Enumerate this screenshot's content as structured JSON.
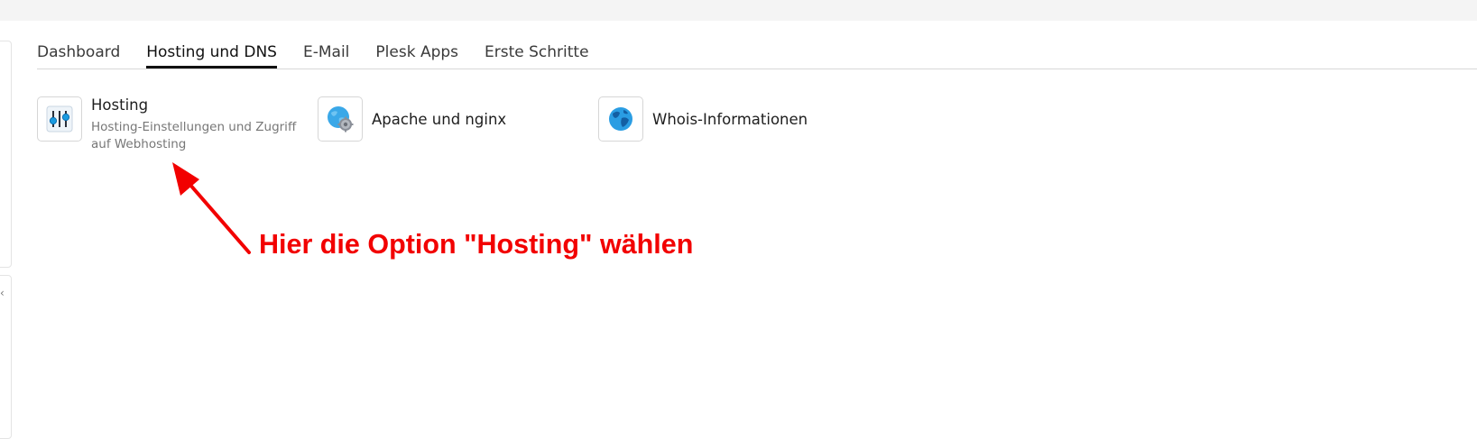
{
  "tabs": [
    {
      "label": "Dashboard",
      "active": false
    },
    {
      "label": "Hosting und DNS",
      "active": true
    },
    {
      "label": "E-Mail",
      "active": false
    },
    {
      "label": "Plesk Apps",
      "active": false
    },
    {
      "label": "Erste Schritte",
      "active": false
    }
  ],
  "tiles": [
    {
      "title": "Hosting",
      "description": "Hosting-Einstellungen und Zugriff auf Webhosting",
      "icon": "sliders-icon"
    },
    {
      "title": "Apache und nginx",
      "description": "",
      "icon": "globe-gear-icon"
    },
    {
      "title": "Whois-Informationen",
      "description": "",
      "icon": "globe-icon"
    }
  ],
  "annotation": {
    "text": "Hier die Option \"Hosting\" wählen",
    "color": "#f20000"
  },
  "colors": {
    "accent_blue": "#1a9be0",
    "top_strip": "#f4f4f4",
    "tab_underline": "#111111"
  }
}
